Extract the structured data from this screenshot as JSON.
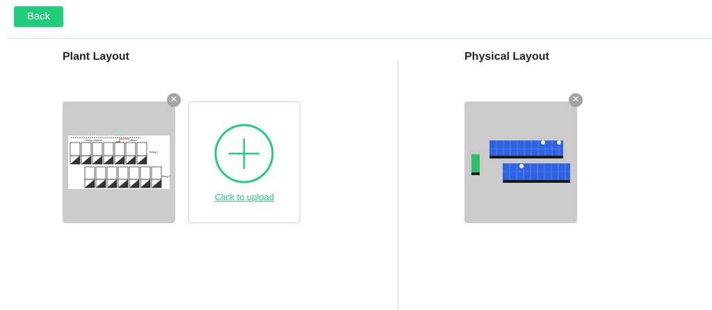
{
  "toolbar": {
    "back_label": "Back"
  },
  "colors": {
    "accent": "#1fcc7a",
    "card_bg": "#cbcbcb",
    "remove_bg": "#a4a4a4",
    "panel_blue": "#2f63e0"
  },
  "plant_layout": {
    "title": "Plant Layout",
    "upload_label": "Click to upload",
    "thumbnail_text": {
      "string_a": "String number",
      "offset": "Offset",
      "string_1": "String 1",
      "string_2": "String 2"
    }
  },
  "physical_layout": {
    "title": "Physical Layout"
  },
  "icons": {
    "remove": "close-icon",
    "upload": "plus-circle-icon"
  }
}
